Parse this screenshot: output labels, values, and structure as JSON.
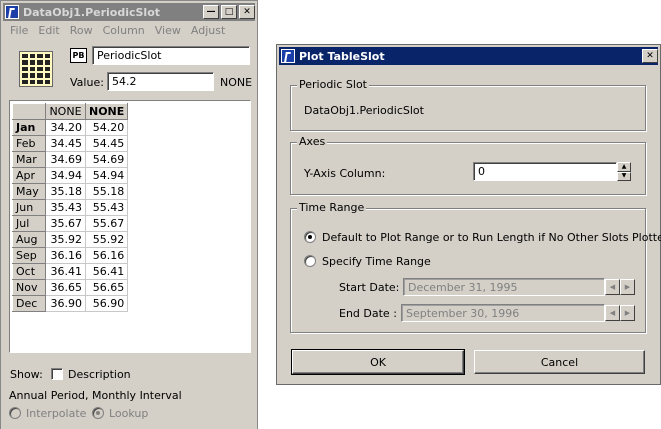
{
  "slot_window": {
    "title": "DataObj1.PeriodicSlot",
    "menu": [
      "File",
      "Edit",
      "Row",
      "Column",
      "View",
      "Adjust"
    ],
    "pb_badge": "PB",
    "slot_name": "PeriodicSlot",
    "value_label": "Value:",
    "value": "54.2",
    "value_units": "NONE",
    "columns": [
      "NONE",
      "NONE"
    ],
    "rows": [
      {
        "label": "Jan",
        "c1": "34.20",
        "c2": "54.20"
      },
      {
        "label": "Feb",
        "c1": "34.45",
        "c2": "54.45"
      },
      {
        "label": "Mar",
        "c1": "34.69",
        "c2": "54.69"
      },
      {
        "label": "Apr",
        "c1": "34.94",
        "c2": "54.94"
      },
      {
        "label": "May",
        "c1": "35.18",
        "c2": "55.18"
      },
      {
        "label": "Jun",
        "c1": "35.43",
        "c2": "55.43"
      },
      {
        "label": "Jul",
        "c1": "35.67",
        "c2": "55.67"
      },
      {
        "label": "Aug",
        "c1": "35.92",
        "c2": "55.92"
      },
      {
        "label": "Sep",
        "c1": "36.16",
        "c2": "56.16"
      },
      {
        "label": "Oct",
        "c1": "36.41",
        "c2": "56.41"
      },
      {
        "label": "Nov",
        "c1": "36.65",
        "c2": "56.65"
      },
      {
        "label": "Dec",
        "c1": "36.90",
        "c2": "56.90"
      }
    ],
    "show_label": "Show:",
    "description_label": "Description",
    "period_text": "Annual Period, Monthly Interval",
    "interpolate_label": "Interpolate",
    "lookup_label": "Lookup"
  },
  "dialog": {
    "title": "Plot TableSlot",
    "periodic_group": "Periodic Slot",
    "periodic_value": "DataObj1.PeriodicSlot",
    "axes_group": "Axes",
    "y_axis_label": "Y-Axis Column:",
    "y_axis_value": "0",
    "time_group": "Time Range",
    "default_option": "Default to Plot Range or to Run Length if No Other Slots Plotted",
    "specify_option": "Specify Time Range",
    "start_label": "Start Date:",
    "start_value": "December 31, 1995",
    "end_label": "End Date :",
    "end_value": "September 30, 1996",
    "ok_label": "OK",
    "cancel_label": "Cancel"
  }
}
